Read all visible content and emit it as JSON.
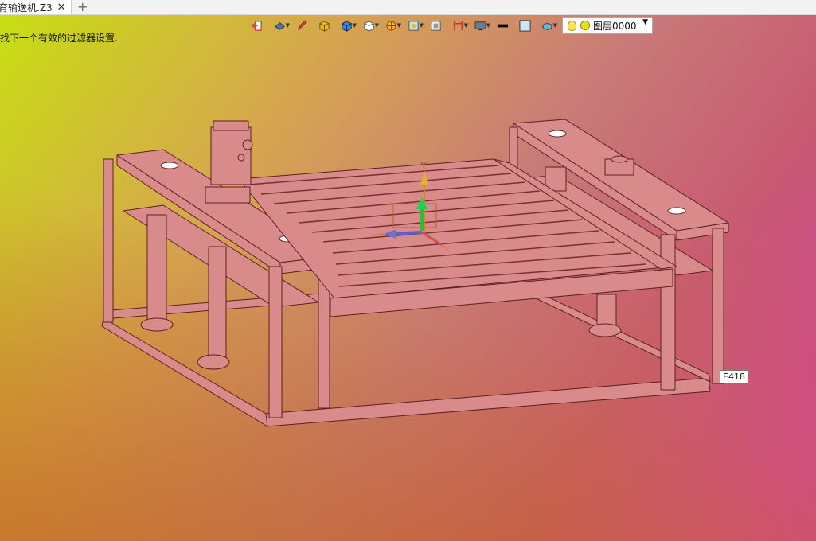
{
  "tab": {
    "title": "育输送机.Z3",
    "close_icon": "close-icon",
    "add_icon": "plus-icon"
  },
  "status_message": "找下一个有效的过滤器设置.",
  "toolbar": {
    "icons": [
      "exit-icon",
      "view-icon",
      "pen-icon",
      "shaded-box-icon",
      "cube-icon",
      "wire-cube-icon",
      "render-icon",
      "snap-icon",
      "section-icon",
      "dimension-icon",
      "display-icon",
      "line-color-icon",
      "fill-color-icon",
      "material-icon"
    ],
    "layer": {
      "name": "图层0000"
    }
  },
  "tooltip": "E418",
  "axes": {
    "y_label": "Y"
  },
  "colors": {
    "model_fill": "#d88a8a",
    "model_edge": "#5a2020",
    "accent": "#c8e010"
  }
}
